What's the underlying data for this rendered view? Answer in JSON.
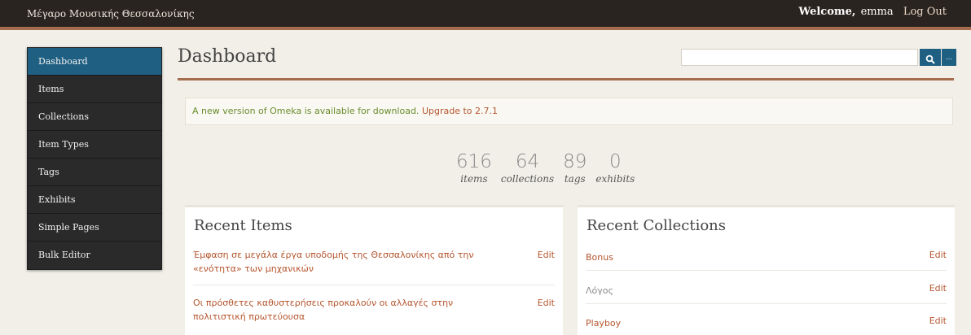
{
  "header": {
    "site_title": "Μέγαρο Μουσικής Θεσσαλονίκης",
    "welcome": "Welcome,",
    "username": "emma",
    "logout": "Log Out"
  },
  "sidebar": {
    "items": [
      {
        "label": "Dashboard",
        "active": true
      },
      {
        "label": "Items"
      },
      {
        "label": "Collections"
      },
      {
        "label": "Item Types"
      },
      {
        "label": "Tags"
      },
      {
        "label": "Exhibits"
      },
      {
        "label": "Simple Pages"
      },
      {
        "label": "Bulk Editor"
      }
    ]
  },
  "page": {
    "title": "Dashboard",
    "search": {
      "placeholder": "",
      "advanced_label": "..."
    }
  },
  "notice": {
    "text": "A new version of Omeka is available for download.",
    "link": "Upgrade to 2.7.1"
  },
  "stats": [
    {
      "value": "616",
      "label": "items"
    },
    {
      "value": "64",
      "label": "collections"
    },
    {
      "value": "89",
      "label": "tags"
    },
    {
      "value": "0",
      "label": "exhibits"
    }
  ],
  "recent_items": {
    "title": "Recent Items",
    "edit_label": "Edit",
    "rows": [
      {
        "title": "Έμφαση σε μεγάλα έργα υποδομής της Θεσσαλονίκης από την «ενότητα» των μηχανικών"
      },
      {
        "title": "Οι πρόσθετες καθυστερήσεις προκαλούν οι αλλαγές στην πολιτιστική πρωτεύουσα"
      }
    ]
  },
  "recent_collections": {
    "title": "Recent Collections",
    "edit_label": "Edit",
    "rows": [
      {
        "title": "Bonus"
      },
      {
        "title": "Λόγος"
      },
      {
        "title": "Playboy"
      }
    ]
  },
  "colors": {
    "topbar": "#2a2420",
    "accent_rule": "#a56d4e",
    "active_nav": "#1f5f82",
    "link": "#b5562f",
    "notice_text": "#6a8c2d"
  }
}
